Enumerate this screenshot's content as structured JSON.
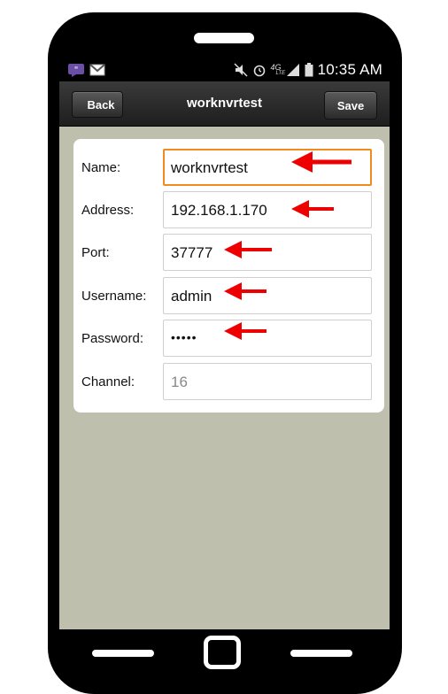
{
  "status_bar": {
    "time": "10:35 AM",
    "network": "4G",
    "network_sub": "LTE",
    "left_icons": [
      "messages-icon",
      "gmail-icon"
    ],
    "right_icons": [
      "mute-icon",
      "alarm-icon",
      "signal-icon",
      "battery-icon"
    ]
  },
  "app_bar": {
    "title": "worknvrtest",
    "back_label": "Back",
    "save_label": "Save"
  },
  "form": {
    "fields": [
      {
        "label": "Name:",
        "value": "worknvrtest",
        "focused": true
      },
      {
        "label": "Address:",
        "value": "192.168.1.170"
      },
      {
        "label": "Port:",
        "value": "37777"
      },
      {
        "label": "Username:",
        "value": "admin"
      },
      {
        "label": "Password:",
        "value": "•••••"
      },
      {
        "label": "Channel:",
        "value": "16",
        "disabled": true
      }
    ]
  },
  "colors": {
    "screen_bg": "#bebfad",
    "focus_border": "#f08c1e",
    "annotation_arrow": "#ee0000"
  }
}
